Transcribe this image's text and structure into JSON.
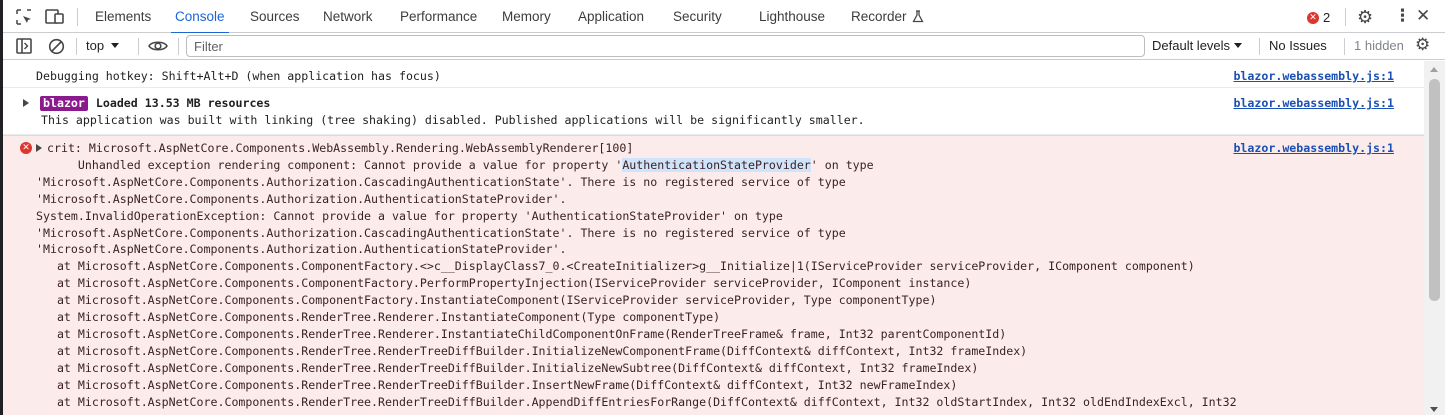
{
  "tabs": [
    "Elements",
    "Console",
    "Sources",
    "Network",
    "Performance",
    "Memory",
    "Application",
    "Security",
    "Lighthouse",
    "Recorder"
  ],
  "error_count": "2",
  "toolbar": {
    "context": "top",
    "filter_placeholder": "Filter",
    "levels": "Default levels",
    "issues": "No Issues",
    "hidden": "1 hidden"
  },
  "messages": {
    "hotkey": "Debugging hotkey: Shift+Alt+D (when application has focus)",
    "blazor_badge": "blazor",
    "loaded": "Loaded 13.53 MB resources",
    "linking": "This application was built with linking (tree shaking) disabled. Published applications will be significantly smaller.",
    "source": "blazor.webassembly.js:1",
    "err_head": "crit: Microsoft.AspNetCore.Components.WebAssembly.Rendering.WebAssemblyRenderer[100]",
    "err_l1_pre": "      Unhandled exception rendering component: Cannot provide a value for property '",
    "err_l1_hl": "AuthenticationStateProvider",
    "err_l1_post": "' on type",
    "err_lines": [
      "'Microsoft.AspNetCore.Components.Authorization.CascadingAuthenticationState'. There is no registered service of type",
      "'Microsoft.AspNetCore.Components.Authorization.AuthenticationStateProvider'.",
      "System.InvalidOperationException: Cannot provide a value for property 'AuthenticationStateProvider' on type",
      "'Microsoft.AspNetCore.Components.Authorization.CascadingAuthenticationState'. There is no registered service of type",
      "'Microsoft.AspNetCore.Components.Authorization.AuthenticationStateProvider'.",
      "   at Microsoft.AspNetCore.Components.ComponentFactory.<>c__DisplayClass7_0.<CreateInitializer>g__Initialize|1(IServiceProvider serviceProvider, IComponent component)",
      "   at Microsoft.AspNetCore.Components.ComponentFactory.PerformPropertyInjection(IServiceProvider serviceProvider, IComponent instance)",
      "   at Microsoft.AspNetCore.Components.ComponentFactory.InstantiateComponent(IServiceProvider serviceProvider, Type componentType)",
      "   at Microsoft.AspNetCore.Components.RenderTree.Renderer.InstantiateComponent(Type componentType)",
      "   at Microsoft.AspNetCore.Components.RenderTree.Renderer.InstantiateChildComponentOnFrame(RenderTreeFrame& frame, Int32 parentComponentId)",
      "   at Microsoft.AspNetCore.Components.RenderTree.RenderTreeDiffBuilder.InitializeNewComponentFrame(DiffContext& diffContext, Int32 frameIndex)",
      "   at Microsoft.AspNetCore.Components.RenderTree.RenderTreeDiffBuilder.InitializeNewSubtree(DiffContext& diffContext, Int32 frameIndex)",
      "   at Microsoft.AspNetCore.Components.RenderTree.RenderTreeDiffBuilder.InsertNewFrame(DiffContext& diffContext, Int32 newFrameIndex)",
      "   at Microsoft.AspNetCore.Components.RenderTree.RenderTreeDiffBuilder.AppendDiffEntriesForRange(DiffContext& diffContext, Int32 oldStartIndex, Int32 oldEndIndexExcl, Int32"
    ]
  }
}
